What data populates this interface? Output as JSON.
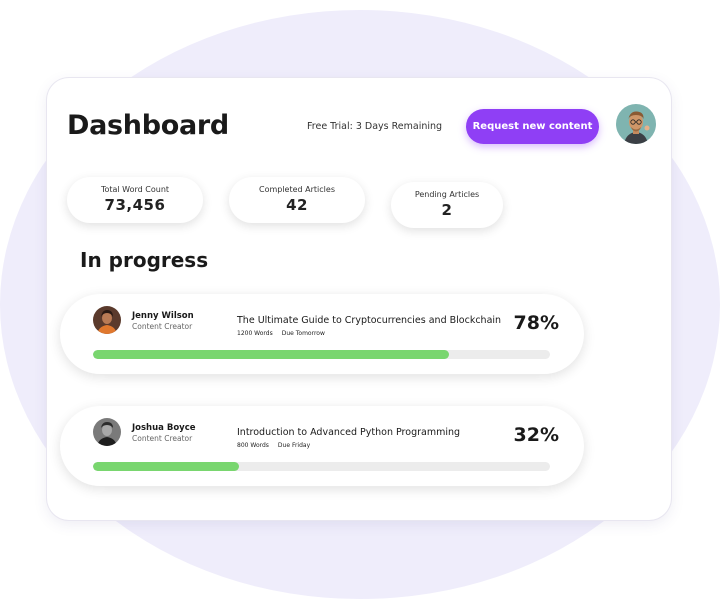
{
  "header": {
    "title": "Dashboard",
    "trial_text": "Free Trial: 3 Days Remaining",
    "cta_label": "Request new content",
    "accent_color": "#8f3ff5"
  },
  "stats": [
    {
      "label": "Total Word Count",
      "value": "73,456"
    },
    {
      "label": "Completed Articles",
      "value": "42"
    },
    {
      "label": "Pending Articles",
      "value": "2"
    }
  ],
  "section_title": "In progress",
  "tasks": [
    {
      "author": "Jenny Wilson",
      "role": "Content Creator",
      "article": "The Ultimate Guide to Cryptocurrencies and Blockchain",
      "words": "1200 Words",
      "due": "Due Tomorrow",
      "percent_label": "78%",
      "progress": 0.78
    },
    {
      "author": "Joshua Boyce",
      "role": "Content Creator",
      "article": "Introduction to Advanced Python Programming",
      "words": "800 Words",
      "due": "Due Friday",
      "percent_label": "32%",
      "progress": 0.32
    }
  ],
  "colors": {
    "progress_fill": "#79d66f",
    "progress_track": "#ececec",
    "background_blob": "#efedfb"
  }
}
